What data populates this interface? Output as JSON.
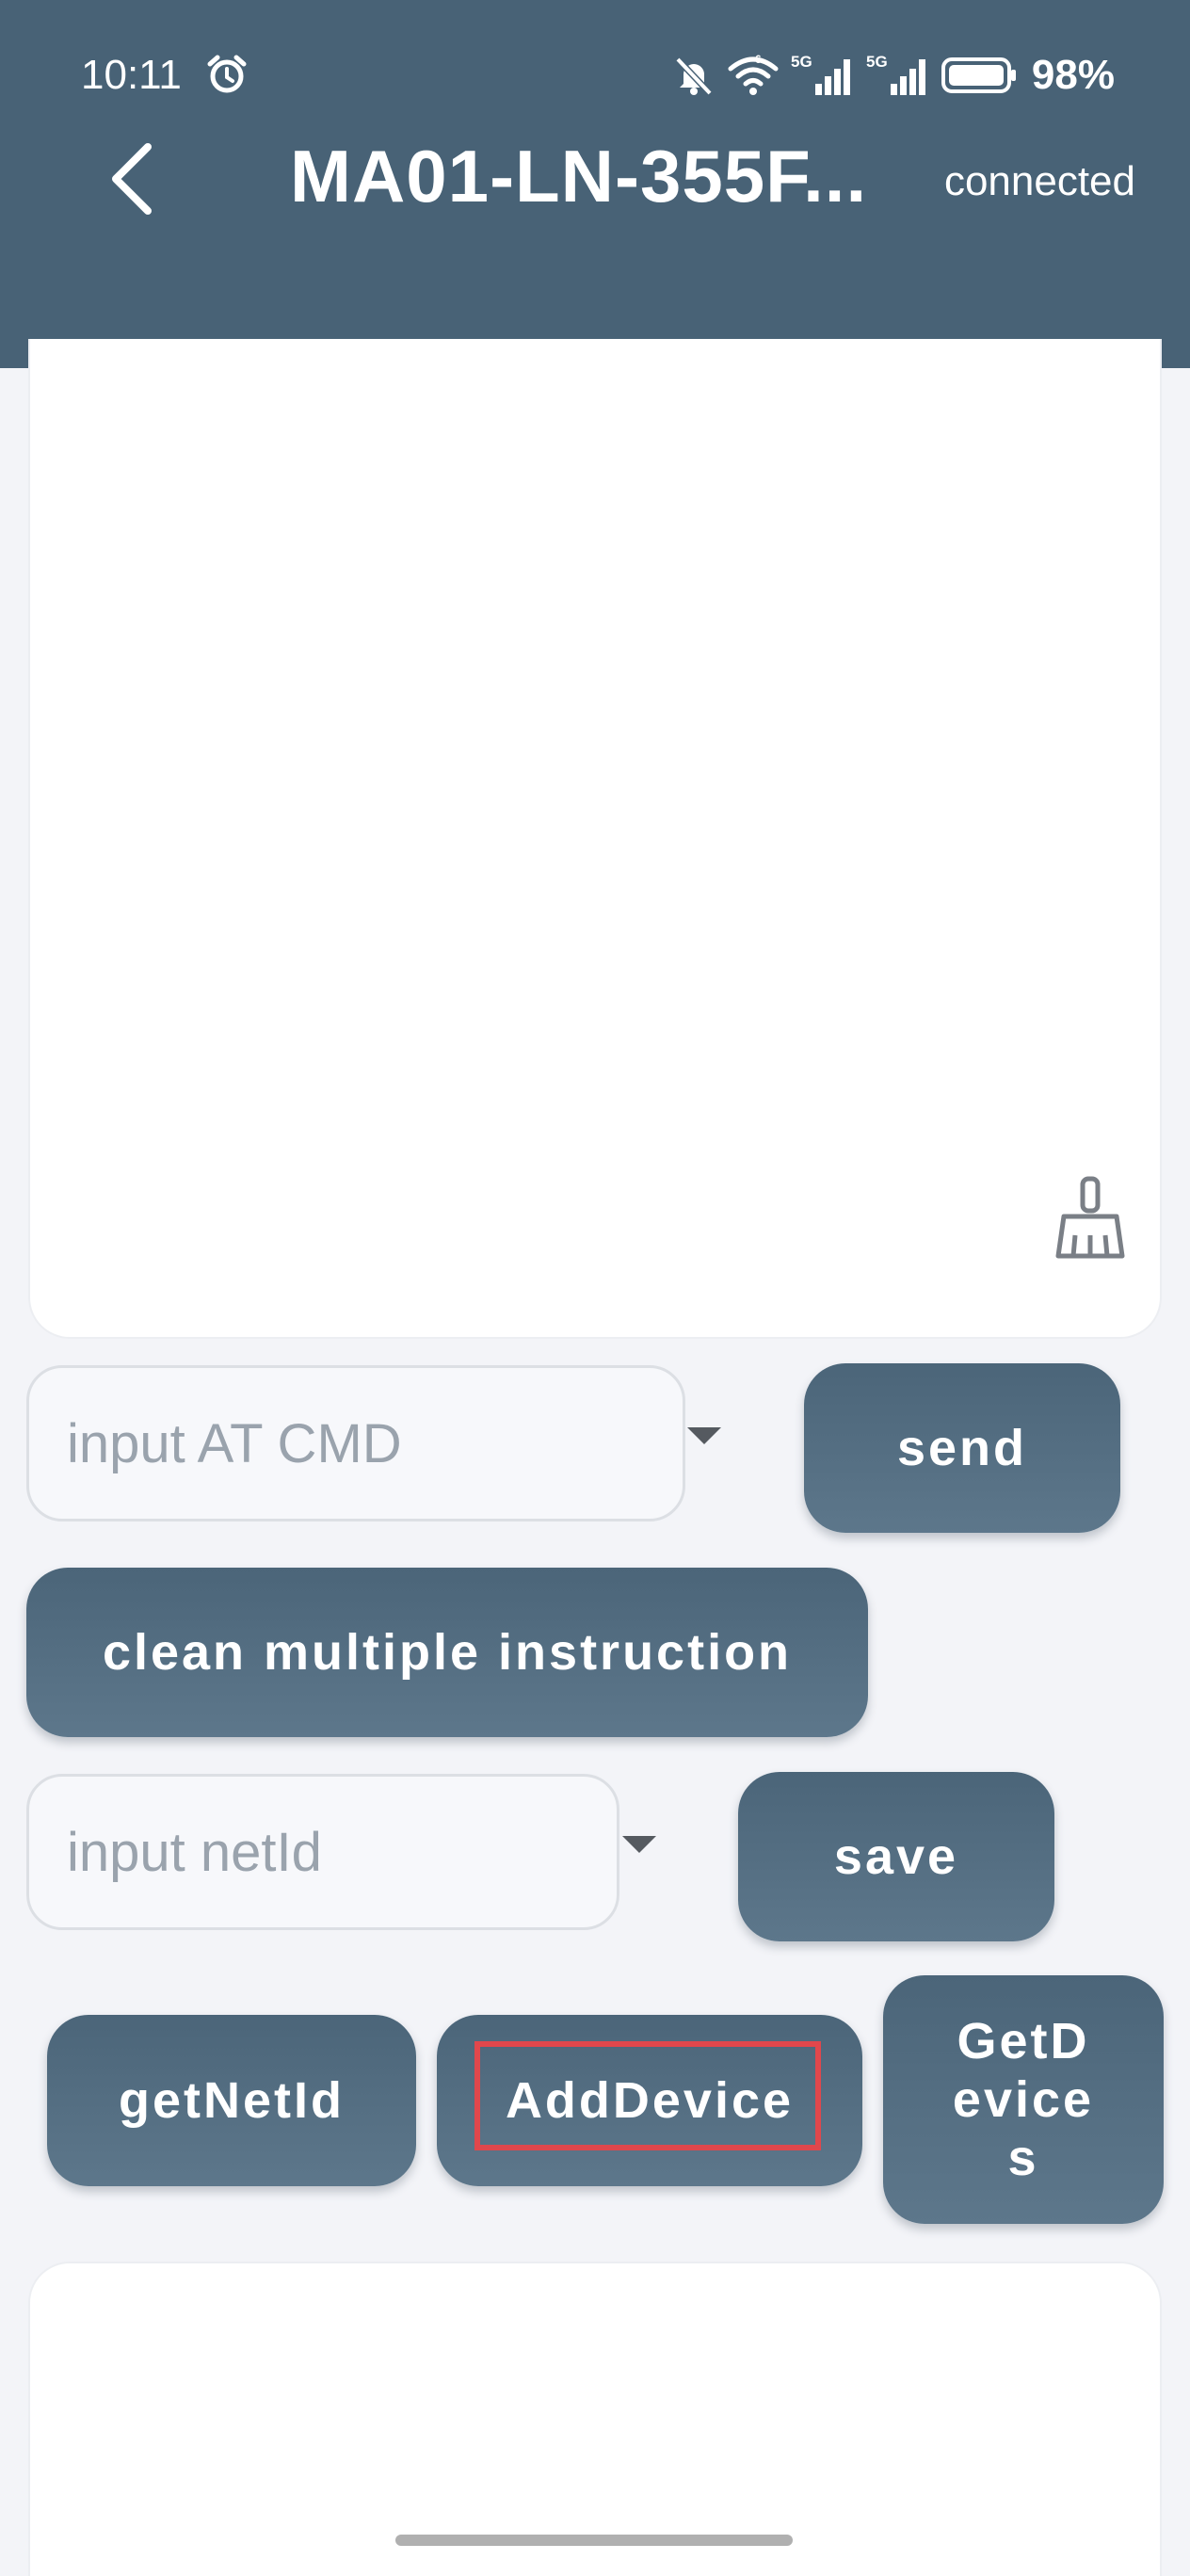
{
  "status_bar": {
    "time": "10:11",
    "battery": "98%",
    "icons": [
      "alarm-icon",
      "mute-bell-icon",
      "wifi-icon",
      "signal-5g-icon",
      "signal-5g-icon",
      "battery-icon"
    ]
  },
  "header": {
    "title": "MA01-LN-355F...",
    "connection_status": "connected",
    "background": "#486276"
  },
  "log_panel": {
    "clear_icon": "broom-icon"
  },
  "at_cmd": {
    "placeholder": "input AT CMD",
    "send_label": "send"
  },
  "clean_label": "clean multiple instruction",
  "net_id": {
    "placeholder": "input netId",
    "save_label": "save"
  },
  "actions": {
    "get_net_id": "getNetId",
    "add_device": "AddDevice",
    "get_devices_line1": "GetD",
    "get_devices_line2": "evice",
    "get_devices_line3": "s"
  },
  "colors": {
    "accent": "#486276",
    "highlight": "#e0474c",
    "background": "#f3f4f8"
  }
}
